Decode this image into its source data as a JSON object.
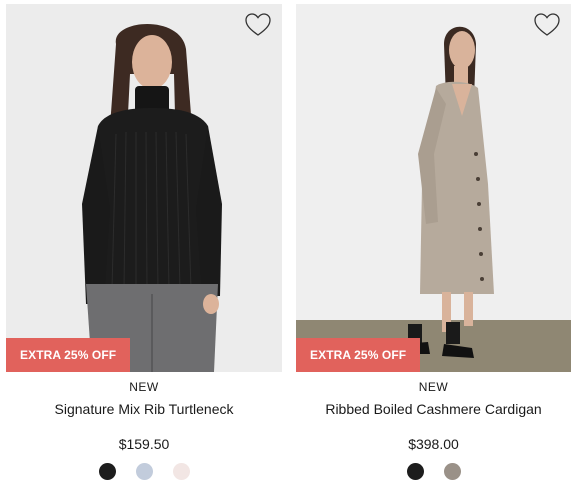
{
  "products": [
    {
      "promo": "EXTRA 25% OFF",
      "badge": "NEW",
      "name": "Signature Mix Rib Turtleneck",
      "price": "$159.50",
      "swatches": [
        "#1d1d1d",
        "#c2ccdc",
        "#f2e6e4"
      ],
      "icons": {
        "wishlist": "heart-outline-icon"
      }
    },
    {
      "promo": "EXTRA 25% OFF",
      "badge": "NEW",
      "name": "Ribbed Boiled Cashmere Cardigan",
      "price": "$398.00",
      "swatches": [
        "#1d1d1d",
        "#9a9188"
      ],
      "icons": {
        "wishlist": "heart-outline-icon"
      }
    }
  ],
  "colors": {
    "promo_bg": "#e1625c",
    "photo_bg": "#ececec"
  }
}
